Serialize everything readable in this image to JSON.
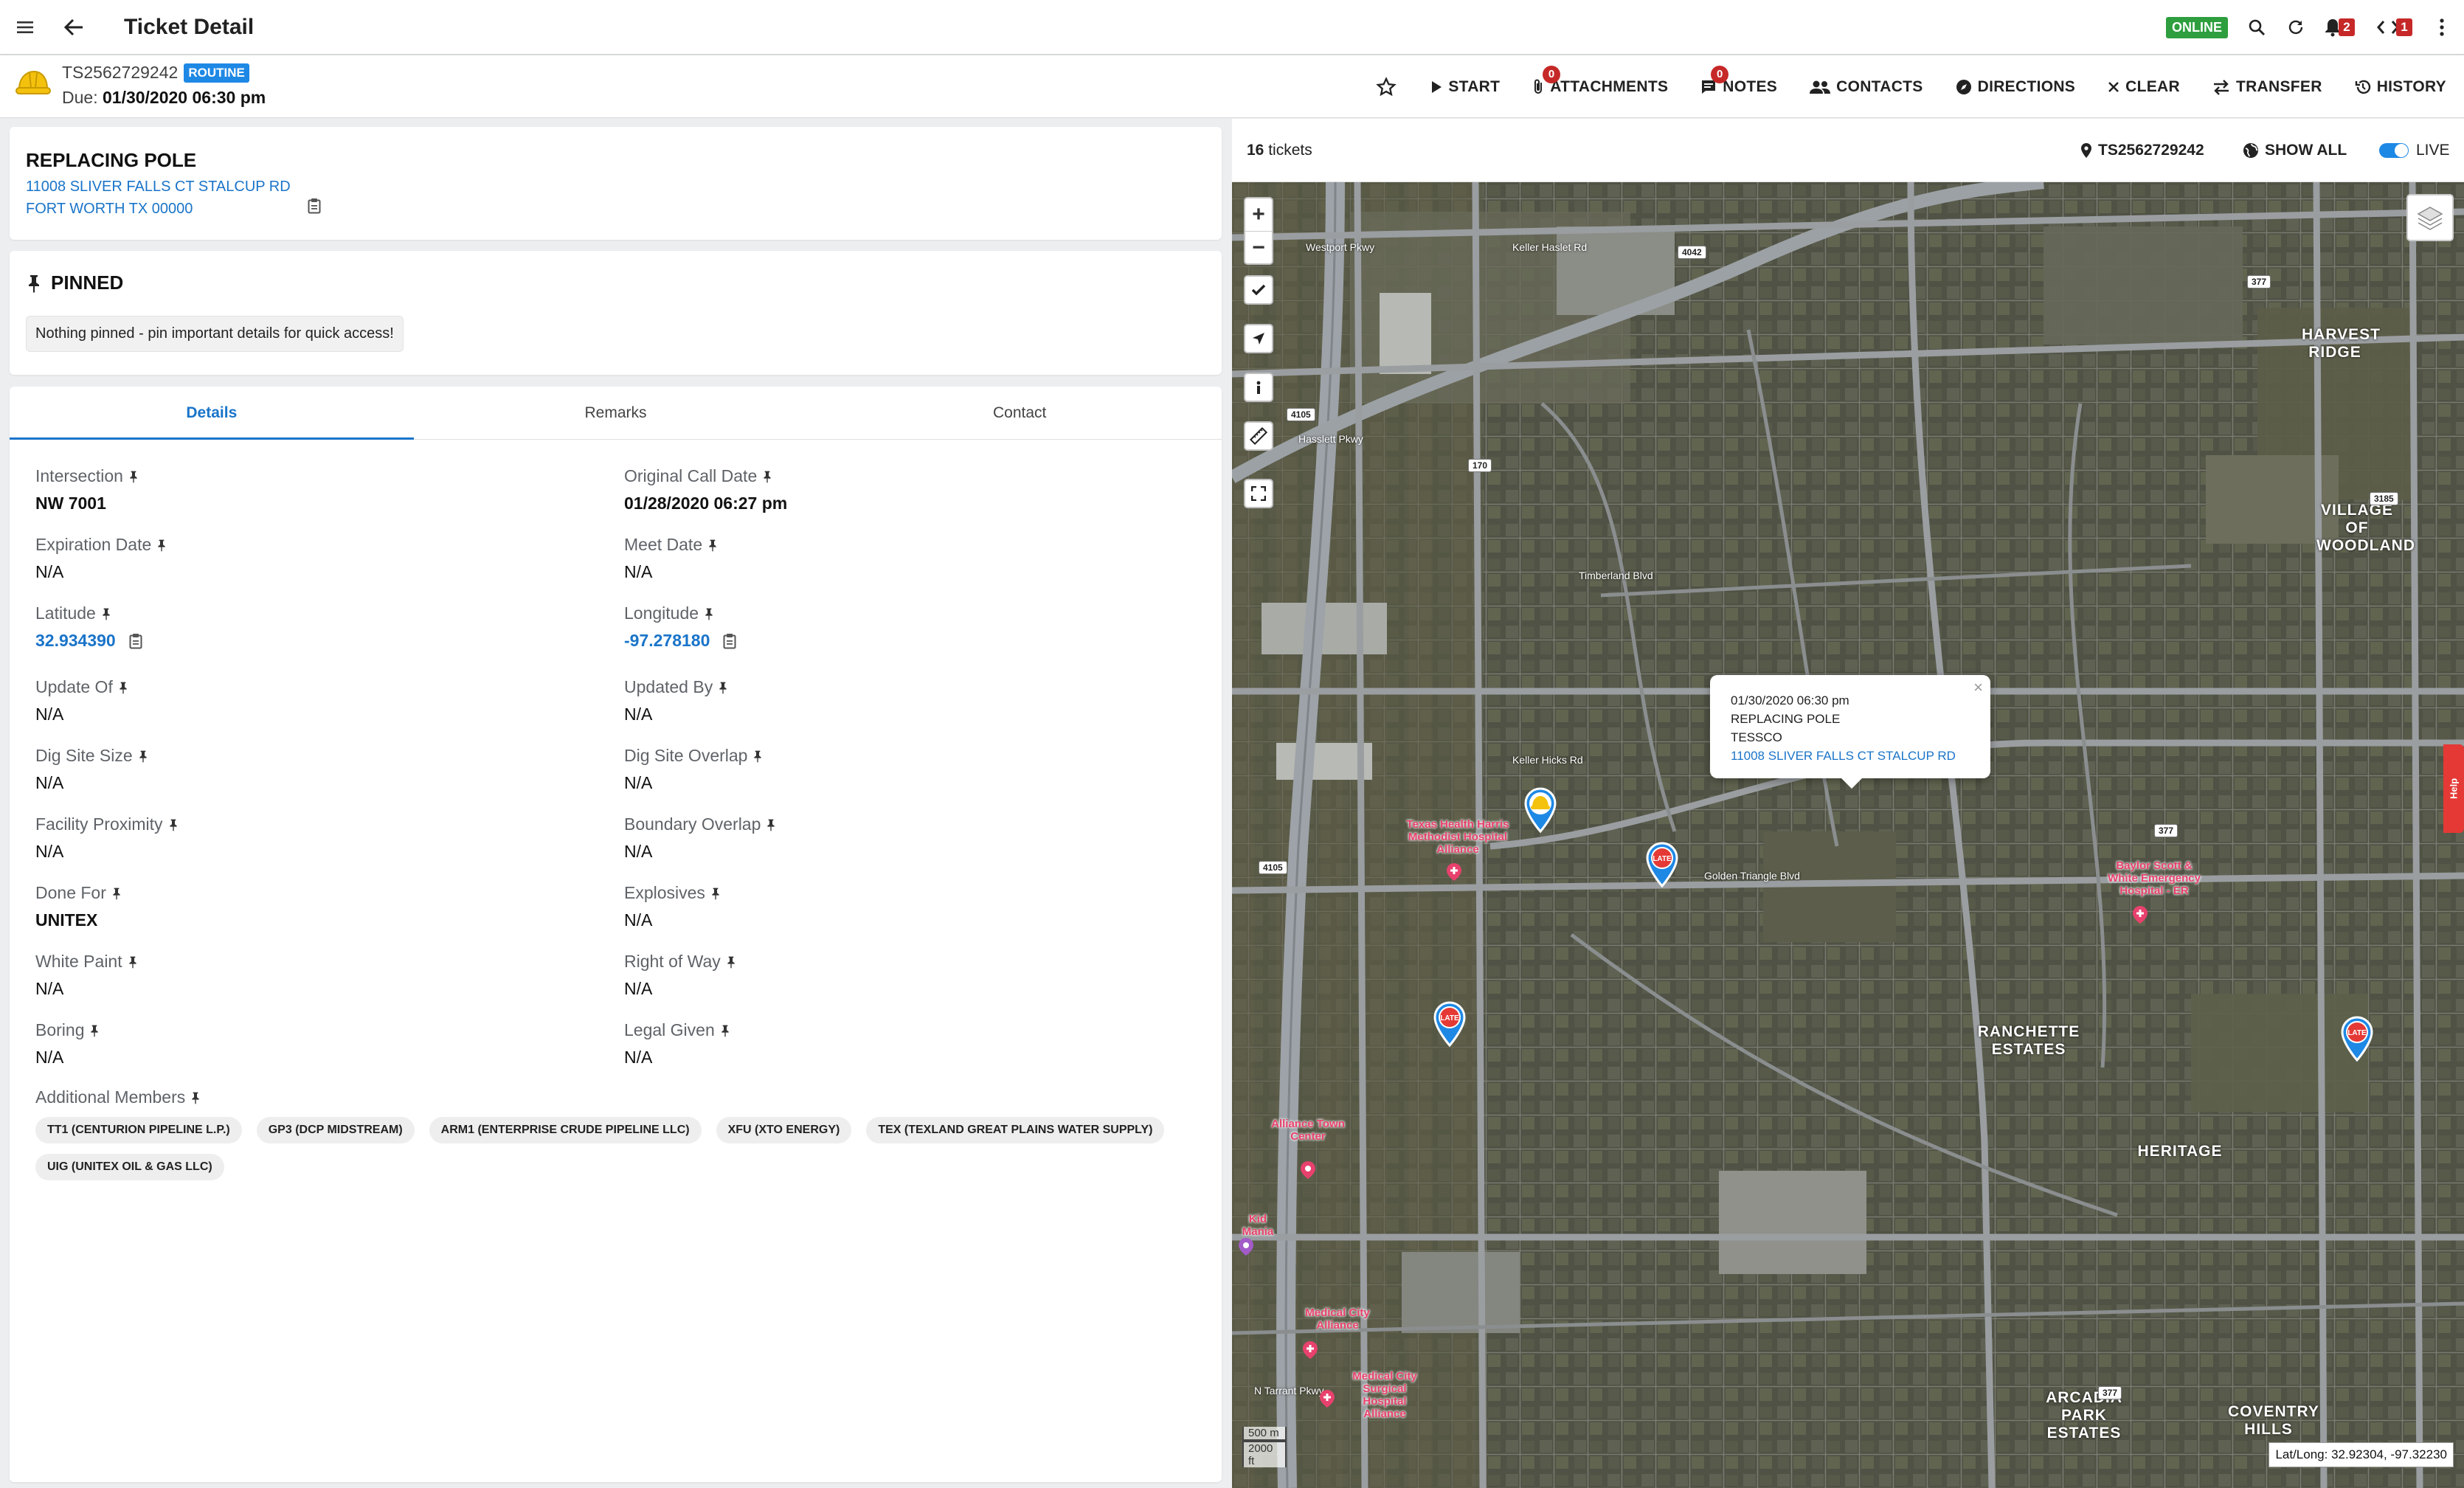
{
  "appbar": {
    "title": "Ticket Detail",
    "online_label": "ONLINE",
    "notifications_count": "2",
    "sync_count": "1"
  },
  "ticket": {
    "id": "TS2562729242",
    "priority": "ROUTINE",
    "due_label": "Due:",
    "due_value": "01/30/2020 06:30 pm"
  },
  "actions": {
    "start": "START",
    "attachments": "ATTACHMENTS",
    "attachments_count": "0",
    "notes": "NOTES",
    "notes_count": "0",
    "contacts": "CONTACTS",
    "directions": "DIRECTIONS",
    "clear": "CLEAR",
    "transfer": "TRANSFER",
    "history": "HISTORY"
  },
  "address_card": {
    "title": "REPLACING POLE",
    "line1": "11008 SLIVER FALLS CT STALCUP RD",
    "line2": "FORT WORTH TX 00000"
  },
  "pinned": {
    "title": "PINNED",
    "empty_text": "Nothing pinned - pin important details for quick access!"
  },
  "tabs": [
    "Details",
    "Remarks",
    "Contact"
  ],
  "details": {
    "intersection": {
      "label": "Intersection",
      "value": "NW 7001"
    },
    "original_call_date": {
      "label": "Original Call Date",
      "value": "01/28/2020 06:27 pm"
    },
    "expiration_date": {
      "label": "Expiration Date",
      "value": "N/A"
    },
    "meet_date": {
      "label": "Meet Date",
      "value": "N/A"
    },
    "latitude": {
      "label": "Latitude",
      "value": "32.934390"
    },
    "longitude": {
      "label": "Longitude",
      "value": "-97.278180"
    },
    "update_of": {
      "label": "Update Of",
      "value": "N/A"
    },
    "updated_by": {
      "label": "Updated By",
      "value": "N/A"
    },
    "dig_site_size": {
      "label": "Dig Site Size",
      "value": "N/A"
    },
    "dig_site_overlap": {
      "label": "Dig Site Overlap",
      "value": "N/A"
    },
    "facility_proximity": {
      "label": "Facility Proximity",
      "value": "N/A"
    },
    "boundary_overlap": {
      "label": "Boundary Overlap",
      "value": "N/A"
    },
    "done_for": {
      "label": "Done For",
      "value": "UNITEX"
    },
    "explosives": {
      "label": "Explosives",
      "value": "N/A"
    },
    "white_paint": {
      "label": "White Paint",
      "value": "N/A"
    },
    "right_of_way": {
      "label": "Right of Way",
      "value": "N/A"
    },
    "boring": {
      "label": "Boring",
      "value": "N/A"
    },
    "legal_given": {
      "label": "Legal Given",
      "value": "N/A"
    },
    "additional_members_label": "Additional Members",
    "additional_members": [
      "TT1 (CENTURION PIPELINE L.P.)",
      "GP3 (DCP MIDSTREAM)",
      "ARM1 (ENTERPRISE CRUDE PIPELINE LLC)",
      "XFU (XTO ENERGY)",
      "TEX (TEXLAND GREAT PLAINS WATER SUPPLY)",
      "UIG (UNITEX OIL & GAS LLC)"
    ]
  },
  "map": {
    "ticket_count": "16",
    "ticket_count_label": "tickets",
    "current_ticket": "TS2562729242",
    "show_all": "SHOW ALL",
    "live": "LIVE",
    "popup": {
      "line1": "01/30/2020 06:30 pm",
      "line2": "REPLACING POLE",
      "line3": "TESSCO",
      "link": "11008 SLIVER FALLS CT STALCUP RD"
    },
    "marker_late_label": "LATE",
    "scale_m": "500 m",
    "scale_ft": "2000 ft",
    "latlong": "Lat/Long: 32.92304, -97.32230",
    "help": "Help",
    "places": [
      "HARVEST RIDGE",
      "VILLAGE OF WOODLAND",
      "RANCHETTE ESTATES",
      "HERITAGE",
      "ARCADIA PARK ESTATES",
      "COVENTRY HILLS"
    ],
    "pois": [
      "Texas Health Harris Methodist Hospital Alliance",
      "Baylor Scott & White Emergency Hospital - ER",
      "Alliance Town Center",
      "Kid Mania",
      "Medical City Alliance",
      "Medical City Surgical Hospital Alliance"
    ],
    "roads": [
      "Westport Pkwy",
      "Keller Haslet Rd",
      "Hasslett Pkwy",
      "Keller Hicks Rd",
      "Golden Triangle Blvd",
      "N Tarrant Pkwy",
      "Timberland Blvd"
    ],
    "shields": [
      "4042",
      "377",
      "4105",
      "170",
      "3185",
      "377",
      "4105",
      "377"
    ]
  },
  "colors": {
    "accent": "#1a74c9",
    "online": "#2e9e3e",
    "badge": "#c62828",
    "routine": "#1e88e5"
  }
}
